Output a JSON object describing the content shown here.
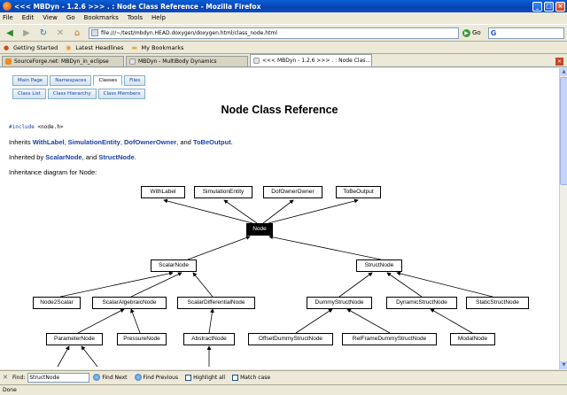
{
  "window": {
    "title": "<<< MBDyn - 1.2.6 >>> . : Node Class Reference - Mozilla Firefox",
    "minimize": "_",
    "maximize": "□",
    "close": "×"
  },
  "menu": [
    "File",
    "Edit",
    "View",
    "Go",
    "Bookmarks",
    "Tools",
    "Help"
  ],
  "nav": {
    "url": "file:///~/test/mbdyn.HEAD.doxygen/doxygen.html/class_node.html",
    "go_label": "Go",
    "search_value": ""
  },
  "bookmarks": [
    {
      "label": "Getting Started",
      "icon": "firefox-icon"
    },
    {
      "label": "Latest Headlines",
      "icon": "rss-icon"
    },
    {
      "label": "My Bookmarks",
      "icon": "folder-icon"
    }
  ],
  "tabs": [
    {
      "label": "SourceForge.net: MBDyn_in_eclipse",
      "active": false,
      "color": "#f08a20"
    },
    {
      "label": "MBDyn - MultiBody Dynamics",
      "active": false,
      "color": "#e4e4e4"
    },
    {
      "label": "<<< MBDyn - 1.2.6 >>> . : Node Clas...",
      "active": true,
      "color": "#e4e4e4"
    }
  ],
  "doxygen": {
    "tabs1": [
      {
        "label": "Main Page",
        "current": false
      },
      {
        "label": "Namespaces",
        "current": false
      },
      {
        "label": "Classes",
        "current": true
      },
      {
        "label": "Files",
        "current": false
      }
    ],
    "tabs2": [
      {
        "label": "Class List",
        "current": false
      },
      {
        "label": "Class Hierarchy",
        "current": false
      },
      {
        "label": "Class Members",
        "current": false
      }
    ],
    "title": "Node Class Reference",
    "include_kw": "#include",
    "include_file": "<node.h>",
    "inherits_prefix": "Inherits",
    "inherits": [
      "WithLabel",
      "SimulationEntity",
      "DofOwnerOwner",
      "ToBeOutput"
    ],
    "inherits_sep1": ", ",
    "inherits_and": ", and ",
    "inherited_prefix": "Inherited by",
    "inherited": [
      "ScalarNode",
      "StructNode"
    ],
    "inherited_and": ", and ",
    "diagram_label": "Inheritance diagram for Node:",
    "diagram_nodes": {
      "withlabel": "WithLabel",
      "simentity": "SimulationEntity",
      "dofowner": "DofOwnerOwner",
      "tobeoutput": "ToBeOutput",
      "node": "Node",
      "scalarnode": "ScalarNode",
      "structnode": "StructNode",
      "node2scalar": "Node2Scalar",
      "scalaralg": "ScalarAlgebraicNode",
      "scalardiff": "ScalarDifferentialNode",
      "dummystruct": "DummyStructNode",
      "dynstruct": "DynamicStructNode",
      "staticstruct": "StaticStructNode",
      "parameter": "ParameterNode",
      "pressure": "PressureNode",
      "abstract": "AbstractNode",
      "offsetdummy": "OffsetDummyStructNode",
      "relframe": "RelFrameDummyStructNode",
      "modal": "ModalNode"
    }
  },
  "findbar": {
    "label": "Find:",
    "value": "StructNode",
    "next": "Find Next",
    "previous": "Find Previous",
    "highlight": "Highlight all",
    "matchcase": "Match case"
  },
  "status": "Done"
}
